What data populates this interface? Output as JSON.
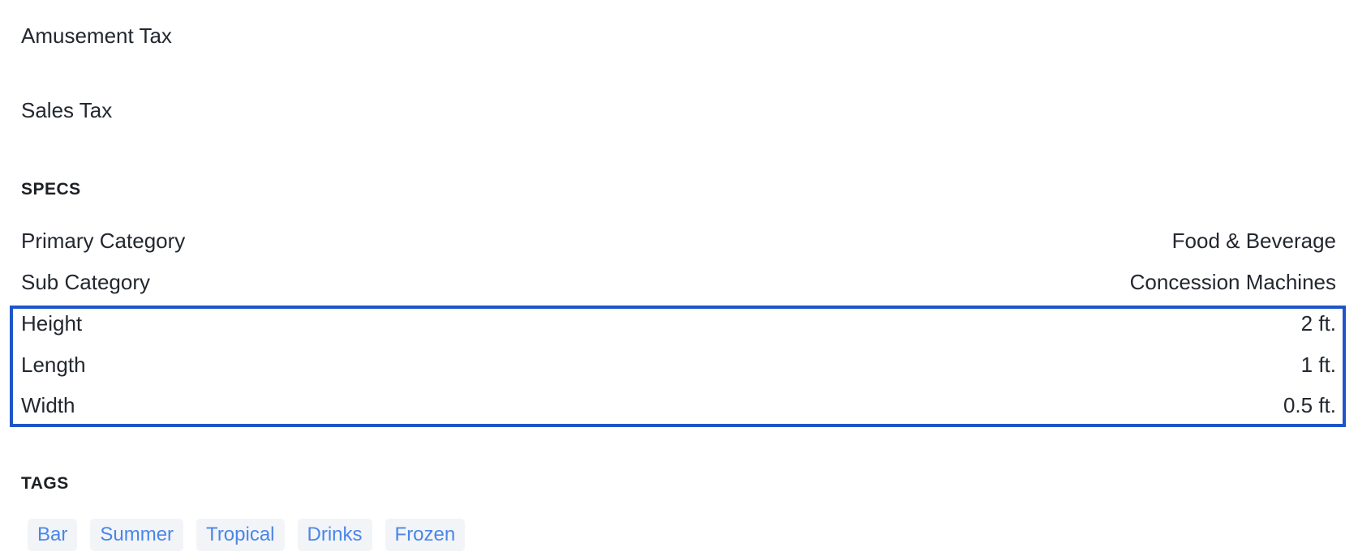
{
  "taxes": {
    "amusement_tax_label": "Amusement Tax",
    "sales_tax_label": "Sales Tax"
  },
  "specs": {
    "heading": "SPECS",
    "rows": [
      {
        "label": "Primary Category",
        "value": "Food & Beverage"
      },
      {
        "label": "Sub Category",
        "value": "Concession Machines"
      },
      {
        "label": "Height",
        "value": "2 ft."
      },
      {
        "label": "Length",
        "value": "1 ft."
      },
      {
        "label": "Width",
        "value": "0.5 ft."
      }
    ]
  },
  "tags": {
    "heading": "TAGS",
    "items": [
      "Bar",
      "Summer",
      "Tropical",
      "Drinks",
      "Frozen"
    ]
  },
  "colors": {
    "highlight_border": "#1f55c8",
    "tag_text": "#4a86e8",
    "tag_background": "#f2f4f7"
  }
}
